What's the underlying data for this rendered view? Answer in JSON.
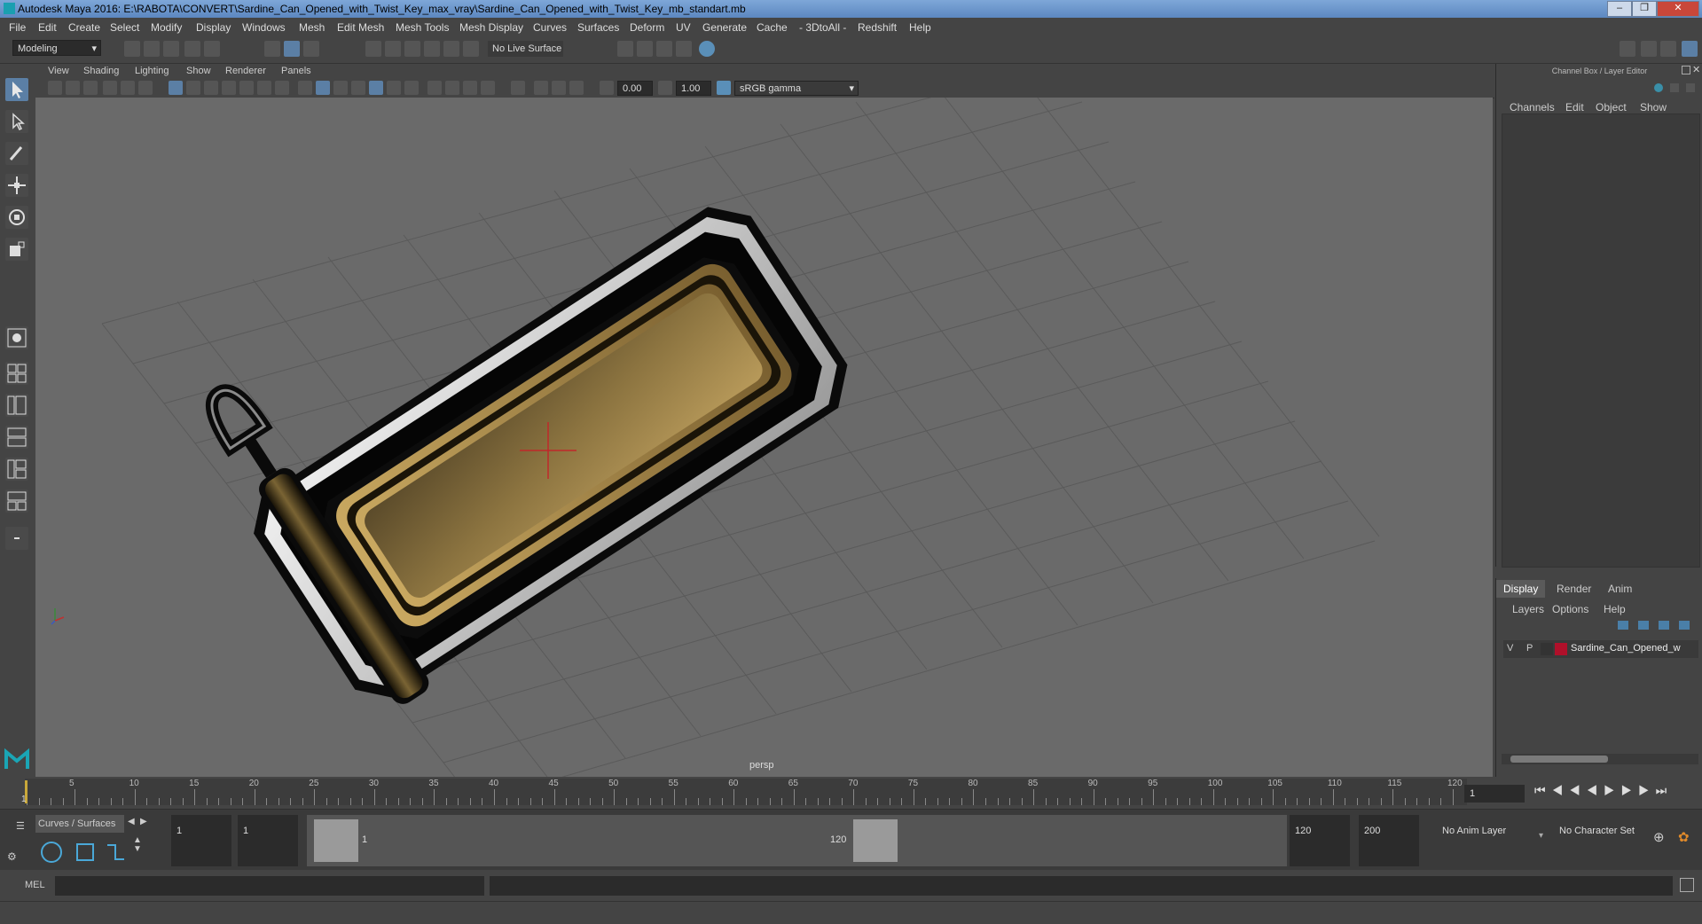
{
  "window": {
    "title": "Autodesk Maya 2016: E:\\RABOTA\\CONVERT\\Sardine_Can_Opened_with_Twist_Key_max_vray\\Sardine_Can_Opened_with_Twist_Key_mb_standart.mb"
  },
  "menubar": [
    "File",
    "Edit",
    "Create",
    "Select",
    "Modify",
    "Display",
    "Windows",
    "Mesh",
    "Edit Mesh",
    "Mesh Tools",
    "Mesh Display",
    "Curves",
    "Surfaces",
    "Deform",
    "UV",
    "Generate",
    "Cache",
    "- 3DtoAll -",
    "Redshift",
    "Help"
  ],
  "status": {
    "mode": "Modeling",
    "live_surface": "No Live Surface"
  },
  "panel_menu": [
    "View",
    "Shading",
    "Lighting",
    "Show",
    "Renderer",
    "Panels"
  ],
  "panel_toolbar": {
    "exposure": "0.00",
    "gamma": "1.00",
    "colorspace": "sRGB gamma"
  },
  "viewport": {
    "camera": "persp"
  },
  "channel_box": {
    "title": "Channel Box / Layer Editor",
    "tabs": [
      "Channels",
      "Edit",
      "Object",
      "Show"
    ]
  },
  "layer_editor": {
    "tabs": [
      "Display",
      "Render",
      "Anim"
    ],
    "menus": [
      "Layers",
      "Options",
      "Help"
    ],
    "layer": {
      "v": "V",
      "p": "P",
      "name": "Sardine_Can_Opened_w",
      "color": "#b0102a"
    }
  },
  "time_slider": {
    "ticks": [
      "5",
      "10",
      "15",
      "20",
      "25",
      "30",
      "35",
      "40",
      "45",
      "50",
      "55",
      "60",
      "65",
      "70",
      "75",
      "80",
      "85",
      "90",
      "95",
      "100",
      "105",
      "110",
      "115",
      "120"
    ],
    "start_marker": "1",
    "current_frame": "1"
  },
  "range": {
    "shelf_tab": "Curves / Surfaces",
    "start": "1",
    "anim_start": "1",
    "range_start": "1",
    "range_end": "120",
    "end": "120",
    "anim_end": "200",
    "anim_layer": "No Anim Layer",
    "character_set": "No Character Set"
  },
  "command_line": {
    "label": "MEL"
  }
}
